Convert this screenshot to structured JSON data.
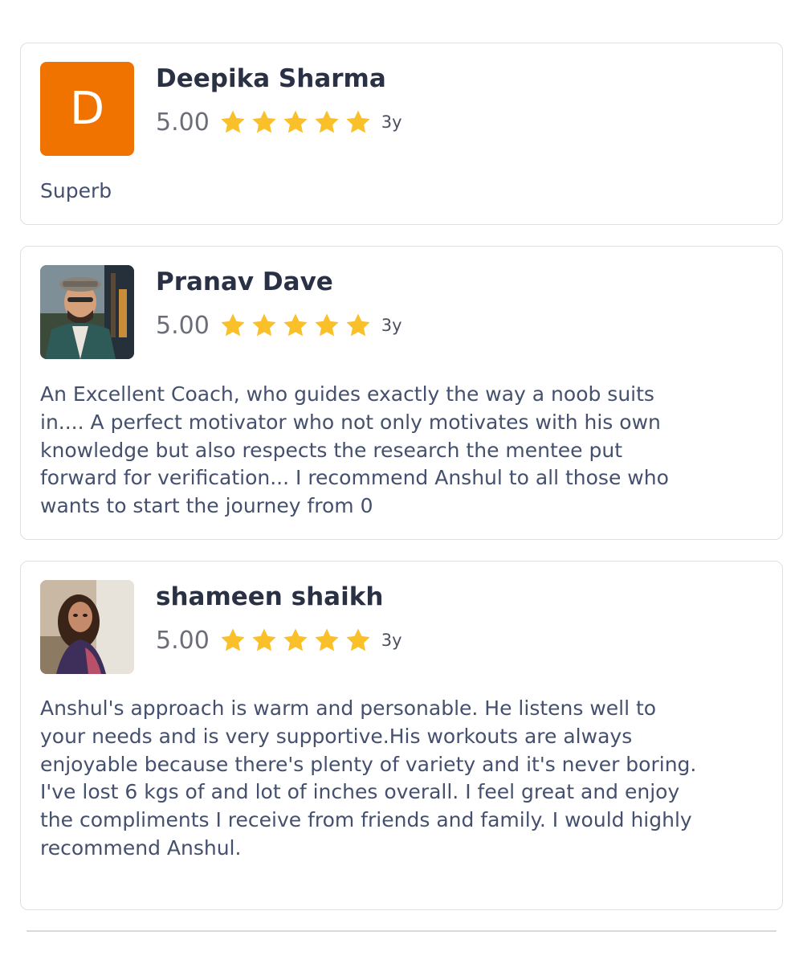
{
  "colors": {
    "star": "#f9c02a",
    "avatar_letter_bg": "#f07300",
    "card_border": "#dedfe3",
    "name_text": "#2b3145",
    "review_text": "#45506e"
  },
  "reviews": [
    {
      "avatar": {
        "type": "letter",
        "letter": "D"
      },
      "name": "Deepika Sharma",
      "score": "5.00",
      "stars": 5,
      "age": "3y",
      "text": "Superb"
    },
    {
      "avatar": {
        "type": "photo",
        "icon": "user-photo-man-in-cap"
      },
      "name": "Pranav Dave",
      "score": "5.00",
      "stars": 5,
      "age": "3y",
      "text": "An Excellent Coach, who guides exactly the way a noob suits\nin.... A perfect motivator who not only motivates with his own\nknowledge but also respects the research the mentee put\nforward for verification... I recommend Anshul to all those who\nwants to start the journey from 0"
    },
    {
      "avatar": {
        "type": "photo",
        "icon": "user-photo-woman-selfie"
      },
      "name": "shameen shaikh",
      "score": "5.00",
      "stars": 5,
      "age": "3y",
      "text": "Anshul's approach is warm and personable. He listens well to\nyour needs and is very supportive.His workouts are always\nenjoyable because there's plenty of variety and it's never boring.\nI've lost 6 kgs of and lot of inches overall. I feel great and enjoy\nthe compliments I receive from friends and family. I would highly\nrecommend  Anshul."
    }
  ]
}
